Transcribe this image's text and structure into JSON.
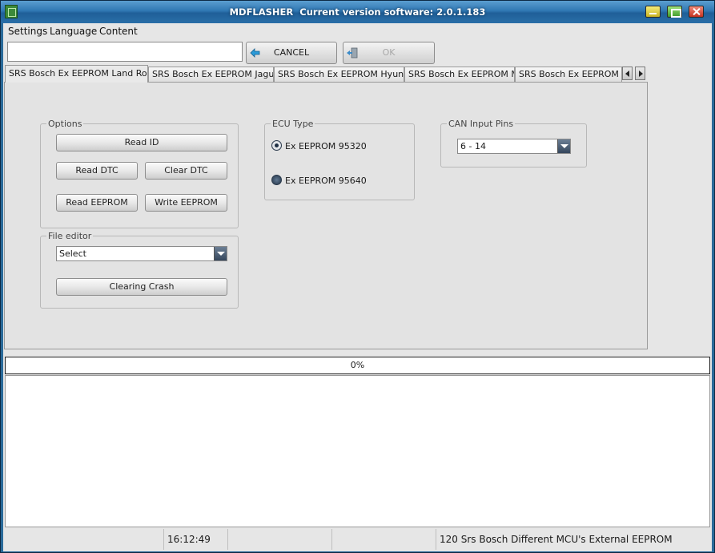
{
  "window": {
    "title": "MDFLASHER  Current version software: 2.0.1.183"
  },
  "menu": {
    "items": [
      "Settings",
      "Language",
      "Content"
    ]
  },
  "toolbar": {
    "path_value": "",
    "cancel_label": "CANCEL",
    "ok_label": "OK"
  },
  "tabs": [
    {
      "label": "SRS Bosch Ex EEPROM Land Rover",
      "active": true
    },
    {
      "label": "SRS Bosch Ex EEPROM Jaguar",
      "active": false
    },
    {
      "label": "SRS Bosch Ex EEPROM Hyundai",
      "active": false
    },
    {
      "label": "SRS Bosch Ex EEPROM MB",
      "active": false
    },
    {
      "label": "SRS Bosch Ex EEPROM Dod",
      "active": false
    }
  ],
  "options": {
    "label": "Options",
    "read_id": "Read ID",
    "read_dtc": "Read DTC",
    "clear_dtc": "Clear DTC",
    "read_eeprom": "Read EEPROM",
    "write_eeprom": "Write EEPROM"
  },
  "file_editor": {
    "label": "File editor",
    "select_value": "Select",
    "clearing_crash": "Clearing Crash"
  },
  "ecu_type": {
    "label": "ECU Type",
    "options": [
      {
        "label": "Ex EEPROM 95320",
        "checked": true
      },
      {
        "label": "Ex EEPROM 95640",
        "checked": false
      }
    ]
  },
  "can_pins": {
    "label": "CAN Input Pins",
    "value": "6 - 14"
  },
  "progress": {
    "text": "0%",
    "value": 0
  },
  "status": {
    "time": "16:12:49",
    "description": "120 Srs Bosch Different MCU's External EEPROM"
  }
}
